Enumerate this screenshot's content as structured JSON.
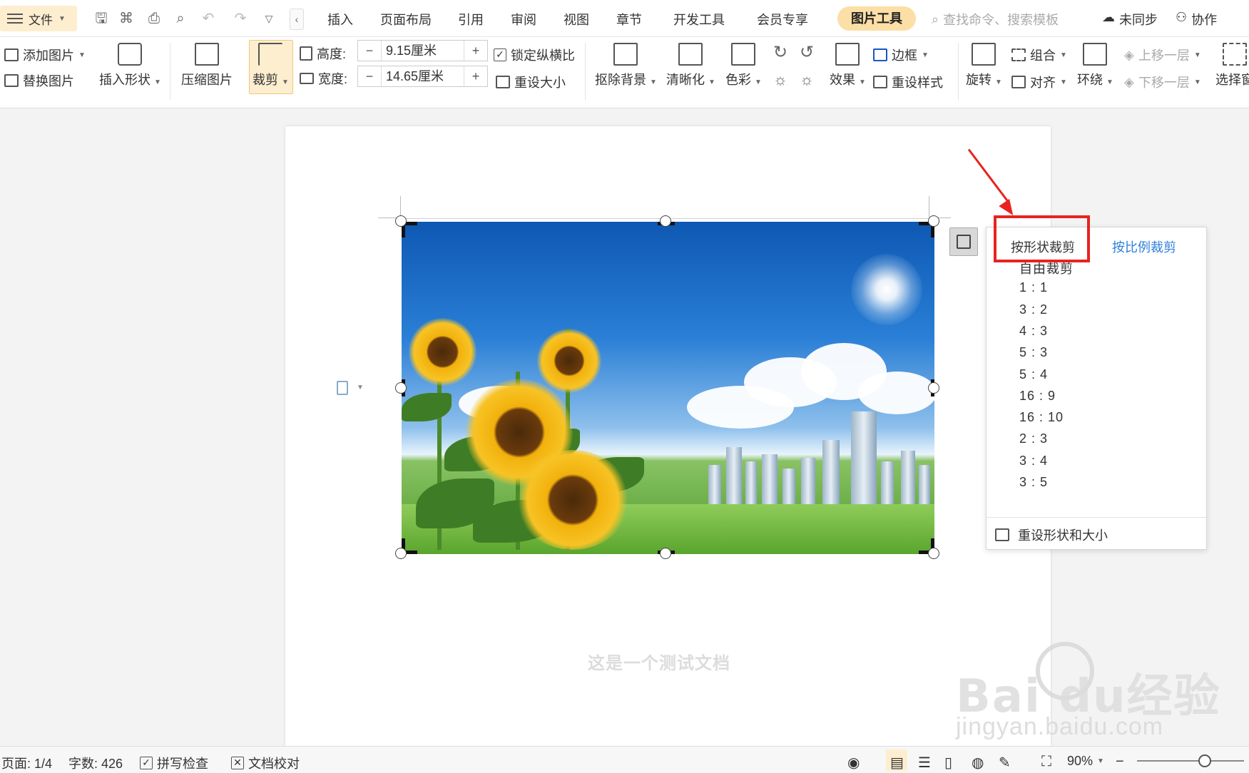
{
  "menubar": {
    "file_label": "文件",
    "items": [
      "插入",
      "页面布局",
      "引用",
      "审阅",
      "视图",
      "章节",
      "开发工具",
      "会员专享"
    ],
    "active_tab": "图片工具",
    "search_placeholder": "查找命令、搜索模板",
    "sync_label": "未同步",
    "collab_label": "协作"
  },
  "ribbon": {
    "add_picture": "添加图片",
    "replace_picture": "替换图片",
    "insert_shape": "插入形状",
    "compress_picture": "压缩图片",
    "crop": "裁剪",
    "height_label": "高度:",
    "height_value": "9.15厘米",
    "width_label": "宽度:",
    "width_value": "14.65厘米",
    "minus": "−",
    "plus": "+",
    "lock_ratio": "锁定纵横比",
    "reset_size": "重设大小",
    "remove_bg": "抠除背景",
    "sharpen": "清晰化",
    "color": "色彩",
    "effects": "效果",
    "border": "边框",
    "reset_style": "重设样式",
    "rotate": "旋转",
    "group": "组合",
    "align": "对齐",
    "wrap": "环绕",
    "bring_forward": "上移一层",
    "send_backward": "下移一层",
    "select_pane": "选择窗"
  },
  "crop_menu": {
    "tab_shape": "按形状裁剪",
    "tab_ratio": "按比例裁剪",
    "options": [
      "自由裁剪",
      "1 : 1",
      "3 : 2",
      "4 : 3",
      "5 : 3",
      "5 : 4",
      "16 : 9",
      "16 : 10",
      "2 : 3",
      "3 : 4",
      "3 : 5"
    ],
    "reset_shape_size": "重设形状和大小"
  },
  "document": {
    "body_text": "这是一个测试文档"
  },
  "watermark": {
    "logo": "Bai du经验",
    "url": "jingyan.baidu.com"
  },
  "statusbar": {
    "page": "页面: 1/4",
    "word_count": "字数: 426",
    "spell_check": "拼写检查",
    "doc_proof": "文档校对",
    "zoom": "90%"
  },
  "colors": {
    "accent_bg": "#fdeed0",
    "annotation_red": "#e8231f",
    "link_blue": "#2f7fd9"
  }
}
